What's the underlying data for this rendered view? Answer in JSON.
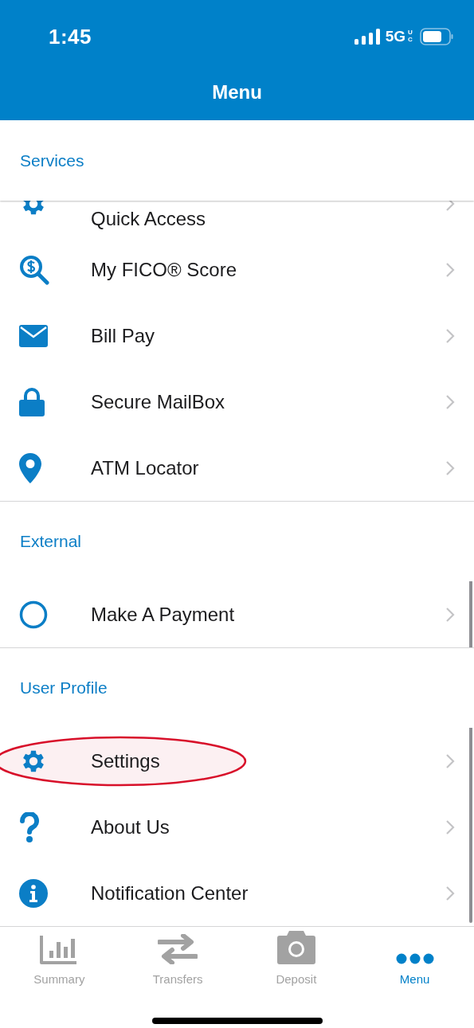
{
  "status_bar": {
    "time": "1:45",
    "network": "5G",
    "network_sub": "UC"
  },
  "header": {
    "title": "Menu"
  },
  "sections": [
    {
      "title": "Services",
      "items": [
        {
          "label": "Quick Access",
          "highlighted": false
        },
        {
          "label": "My FICO® Score",
          "highlighted": false
        },
        {
          "label": "Bill Pay",
          "highlighted": false
        },
        {
          "label": "Secure MailBox",
          "highlighted": false
        },
        {
          "label": "ATM Locator",
          "highlighted": false
        }
      ]
    },
    {
      "title": "External",
      "items": [
        {
          "label": "Make A Payment",
          "highlighted": false
        }
      ]
    },
    {
      "title": "User Profile",
      "items": [
        {
          "label": "Settings",
          "highlighted": true
        },
        {
          "label": "About Us",
          "highlighted": false
        },
        {
          "label": "Notification Center",
          "highlighted": false
        }
      ]
    }
  ],
  "tab_bar": [
    {
      "label": "Summary",
      "selected": false
    },
    {
      "label": "Transfers",
      "selected": false
    },
    {
      "label": "Deposit",
      "selected": false
    },
    {
      "label": "Menu",
      "selected": true
    }
  ]
}
